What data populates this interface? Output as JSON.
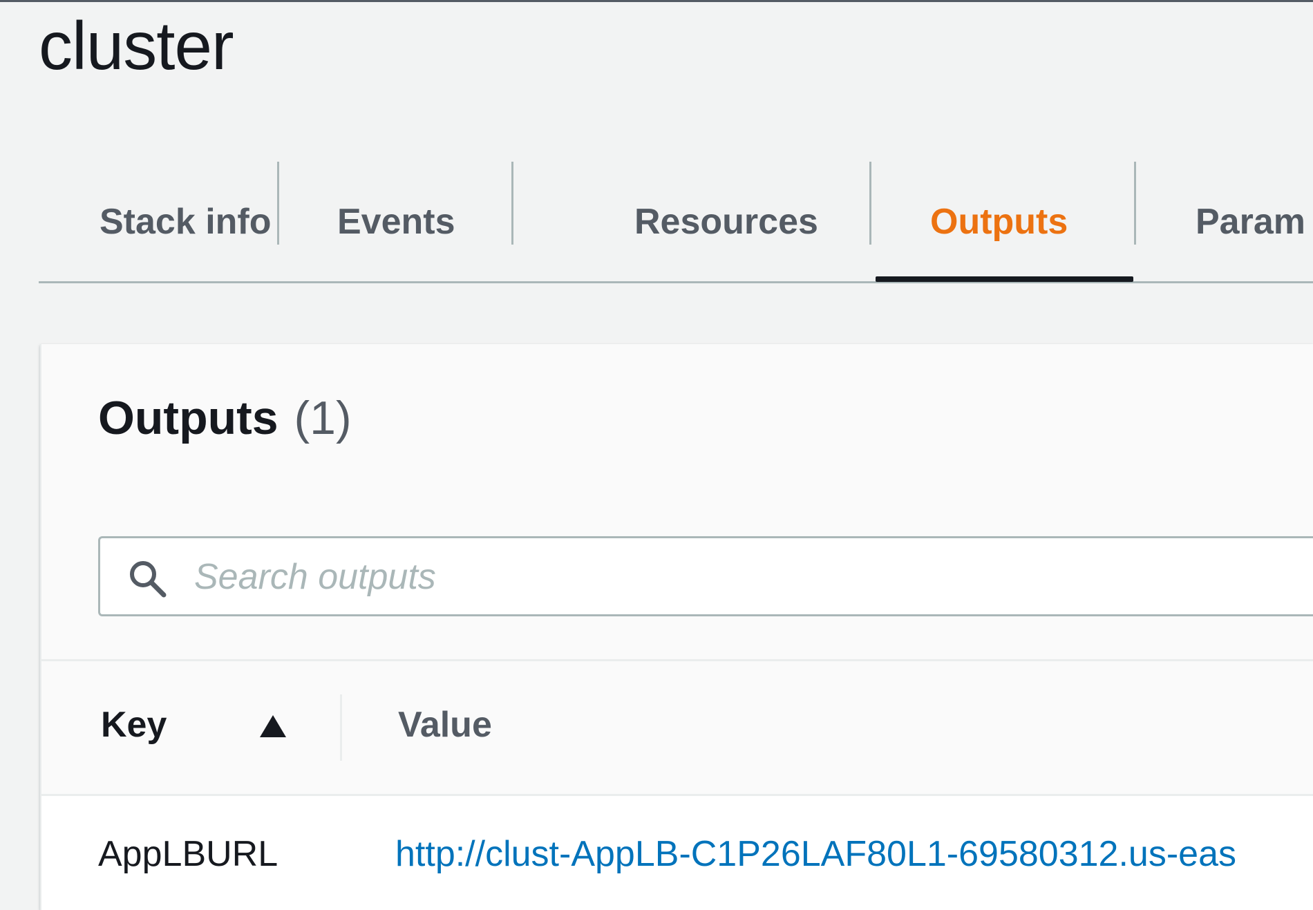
{
  "page": {
    "title": "cluster"
  },
  "tabs": [
    {
      "label": "Stack info",
      "active": false
    },
    {
      "label": "Events",
      "active": false
    },
    {
      "label": "Resources",
      "active": false
    },
    {
      "label": "Outputs",
      "active": true
    },
    {
      "label": "Param",
      "active": false
    }
  ],
  "colors": {
    "active_tab": "#ec7211",
    "link": "#0073bb",
    "text": "#16191f",
    "muted": "#545b64"
  },
  "outputs_panel": {
    "title": "Outputs",
    "count": "(1)",
    "search": {
      "placeholder": "Search outputs",
      "value": "",
      "icon": "search-icon"
    },
    "table": {
      "columns": [
        {
          "label": "Key",
          "sort": "ascending",
          "icon": "sort-ascending-icon"
        },
        {
          "label": "Value"
        }
      ],
      "rows": [
        {
          "key": "AppLBURL",
          "value": "http://clust-AppLB-C1P26LAF80L1-69580312.us-eas"
        }
      ]
    }
  }
}
